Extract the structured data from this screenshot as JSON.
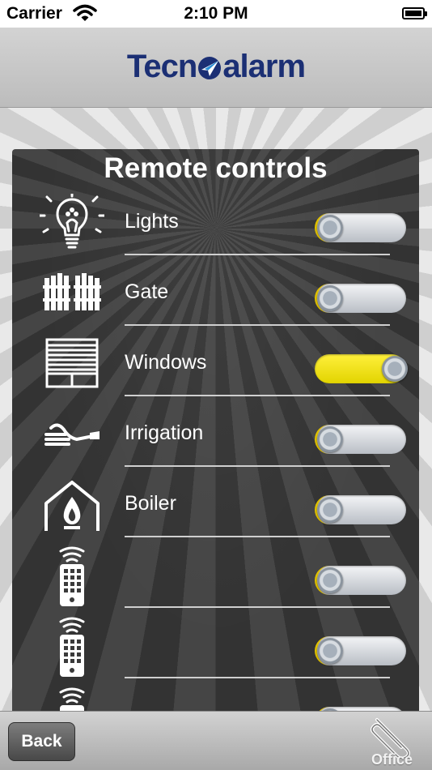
{
  "status_bar": {
    "carrier": "Carrier",
    "time": "2:10 PM",
    "wifi_icon": "wifi-icon",
    "battery_icon": "battery-full-icon"
  },
  "header": {
    "logo_left": "Tecn",
    "logo_right": "alarm",
    "logo_icon": "paper-plane-logo",
    "brand_color": "#1b2f74"
  },
  "panel": {
    "title": "Remote controls",
    "items": [
      {
        "label": "Lights",
        "icon": "lightbulb-icon",
        "on": false
      },
      {
        "label": "Gate",
        "icon": "gate-icon",
        "on": false
      },
      {
        "label": "Windows",
        "icon": "shutter-icon",
        "on": true
      },
      {
        "label": "Irrigation",
        "icon": "hose-icon",
        "on": false
      },
      {
        "label": "Boiler",
        "icon": "boiler-flame-icon",
        "on": false
      },
      {
        "label": "",
        "icon": "remote-control-icon",
        "on": false
      },
      {
        "label": "",
        "icon": "remote-control-icon",
        "on": false
      },
      {
        "label": "",
        "icon": "remote-control-icon",
        "on": false
      }
    ]
  },
  "colors": {
    "toggle_on": "#f3e200",
    "toggle_off": "#d8dce1"
  },
  "bottom_bar": {
    "back_label": "Back",
    "office_label": "Office",
    "office_icon": "paperclip-icon"
  }
}
